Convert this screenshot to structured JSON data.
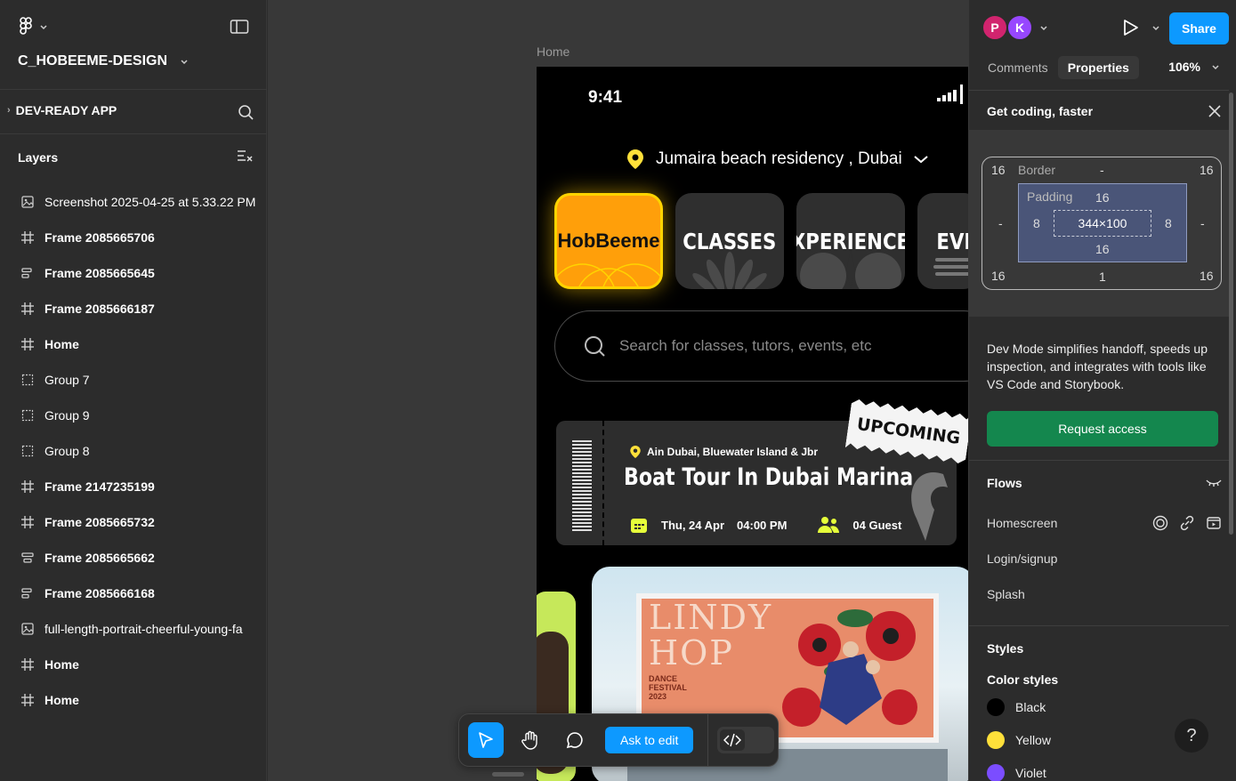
{
  "left_panel": {
    "file_name": "C_HOBEEME-DESIGN",
    "page_name": "DEV-READY APP",
    "layers_title": "Layers",
    "layers": [
      {
        "icon": "image-icon",
        "name": "Screenshot 2025-04-25 at 5.33.22 PM",
        "bold": false
      },
      {
        "icon": "frame-icon",
        "name": "Frame 2085665706",
        "bold": true
      },
      {
        "icon": "autolayout-icon",
        "name": "Frame 2085665645",
        "bold": true
      },
      {
        "icon": "frame-icon",
        "name": "Frame 2085666187",
        "bold": true
      },
      {
        "icon": "frame-icon",
        "name": "Home",
        "bold": true
      },
      {
        "icon": "group-icon",
        "name": "Group 7",
        "bold": false
      },
      {
        "icon": "group-icon",
        "name": "Group 9",
        "bold": false
      },
      {
        "icon": "group-icon",
        "name": "Group 8",
        "bold": false
      },
      {
        "icon": "frame-icon",
        "name": "Frame 2147235199",
        "bold": true
      },
      {
        "icon": "frame-icon",
        "name": "Frame 2085665732",
        "bold": true
      },
      {
        "icon": "autolayout-vertical-icon",
        "name": "Frame 2085665662",
        "bold": true
      },
      {
        "icon": "autolayout-icon",
        "name": "Frame 2085666168",
        "bold": true
      },
      {
        "icon": "image-icon",
        "name": "full-length-portrait-cheerful-young-fa",
        "bold": false
      },
      {
        "icon": "frame-icon",
        "name": "Home",
        "bold": true
      },
      {
        "icon": "frame-icon",
        "name": "Home",
        "bold": true
      }
    ]
  },
  "canvas": {
    "frame_label": "Home",
    "phone": {
      "time": "9:41",
      "location": "Jumaira beach residency , Dubai",
      "categories": [
        "HobBeeme",
        "CLASSES",
        "EXPERIENCES",
        "EVI"
      ],
      "search_placeholder": "Search for classes, tutors, events, etc",
      "ticket": {
        "badge": "UPCOMING",
        "location": "Ain Dubai, Bluewater Island & Jbr",
        "title": "Boat Tour In Dubai Marina",
        "date": "Thu, 24 Apr",
        "time": "04:00 PM",
        "guests": "04 Guest"
      },
      "poster": {
        "line1": "LINDY",
        "line2": "HOP",
        "sub": "DANCE\nFESTIVAL\n2023"
      }
    },
    "toolbar": {
      "ask_label": "Ask to edit"
    }
  },
  "right_panel": {
    "avatars": [
      {
        "letter": "P",
        "color": "#d1246e"
      },
      {
        "letter": "K",
        "color": "#9747ff"
      }
    ],
    "share_label": "Share",
    "tabs": [
      "Comments",
      "Properties"
    ],
    "zoom": "106%",
    "promo": {
      "title": "Get coding, faster",
      "text": "Dev Mode simplifies handoff, speeds up inspection, and integrates with tools like VS Code and Storybook.",
      "button": "Request access"
    },
    "box_model": {
      "border_label": "Border",
      "border_top": "-",
      "border_left": "-",
      "border_right": "-",
      "border_bottom": "1",
      "padding_label": "Padding",
      "pad_top": "16",
      "pad_left": "8",
      "pad_right": "8",
      "pad_bottom": "16",
      "size": "344×100",
      "radius_tl": "16",
      "radius_tr": "16",
      "radius_bl": "16",
      "radius_br": "16"
    },
    "flows": {
      "title": "Flows",
      "items": [
        "Homescreen",
        "Login/signup",
        "Splash"
      ]
    },
    "styles": {
      "title": "Styles",
      "subtitle": "Color styles",
      "colors": [
        {
          "name": "Black",
          "hex": "#000000"
        },
        {
          "name": "Yellow",
          "hex": "#ffe03a"
        },
        {
          "name": "Violet",
          "hex": "#7b4dff"
        }
      ]
    },
    "help": "?"
  }
}
